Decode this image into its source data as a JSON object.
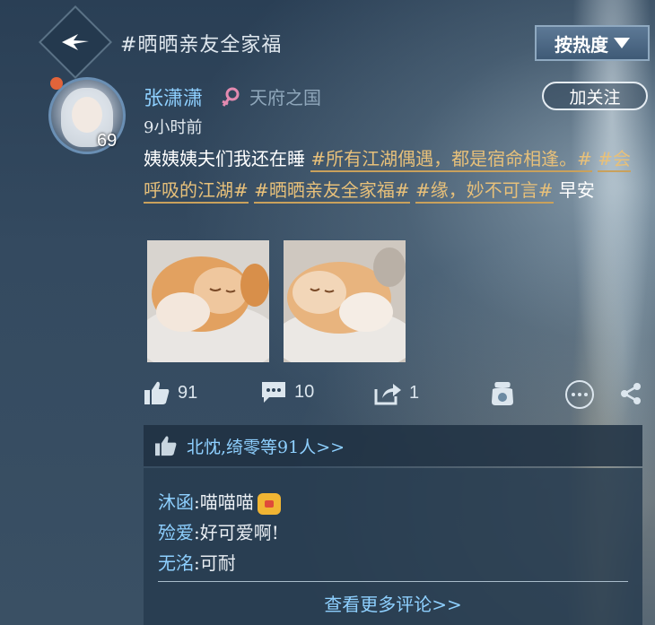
{
  "header": {
    "topic": "#晒晒亲友全家福",
    "sort_label": "按热度"
  },
  "post": {
    "author": {
      "name": "张潇潇",
      "server": "天府之国",
      "level": "69"
    },
    "time": "9小时前",
    "follow_label": "加关注",
    "text_parts": {
      "intro": "姨姨姨夫们我还在睡 ",
      "tag1": "#所有江湖偶遇，都是宿命相逢。#",
      "tag2": "#会呼吸的江湖#",
      "tag3": "#晒晒亲友全家福#",
      "tag4": "#缘，妙不可言#",
      "outro": " 早安"
    },
    "photos": [
      "cat-photo-1",
      "cat-photo-2"
    ],
    "stats": {
      "likes": "91",
      "comments": "10",
      "shares": "1"
    }
  },
  "likes_summary": "北忱,绮零等91人>>",
  "comments": [
    {
      "author": "沐函",
      "text": "喵喵喵"
    },
    {
      "author": "殓爱",
      "text": "好可爱啊!"
    },
    {
      "author": "无洺",
      "text": "可耐"
    }
  ],
  "more_comments_label": "查看更多评论>>",
  "colors": {
    "accent_blue": "#8ed0ff",
    "tag_gold": "#e7c07a",
    "background": "#2d4257"
  }
}
